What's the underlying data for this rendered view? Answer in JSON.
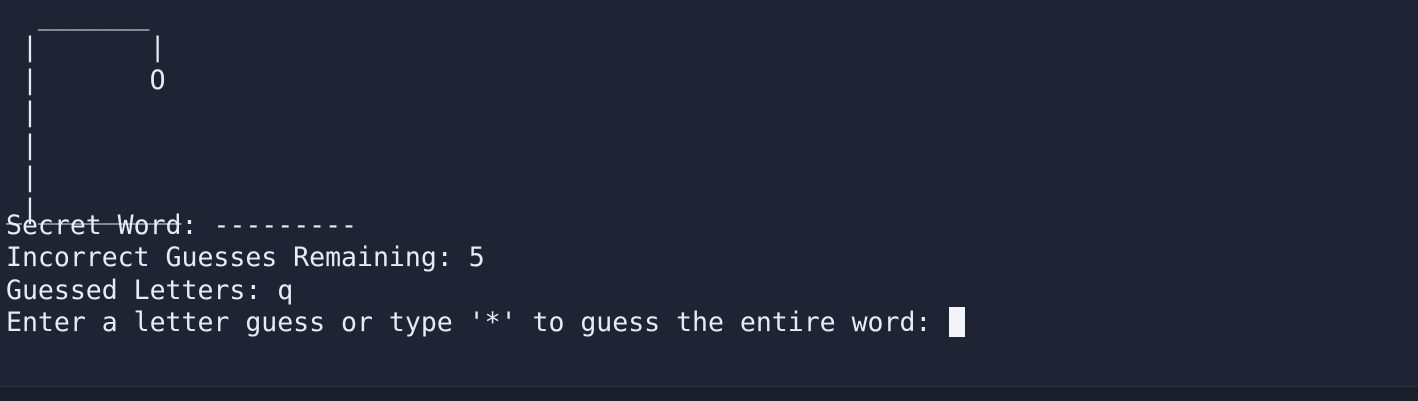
{
  "gallows": {
    "lines": [
      "  _______",
      " |       |",
      " |       O",
      " |",
      " |",
      " |",
      "_|_________"
    ]
  },
  "status": {
    "secret_word_label": "Secret Word: ",
    "secret_word_value": "---------",
    "remaining_label": "Incorrect Guesses Remaining: ",
    "remaining_value": "5",
    "guessed_label": "Guessed Letters: ",
    "guessed_value": "q"
  },
  "prompt": {
    "text": "Enter a letter guess or type '*' to guess the entire word: "
  }
}
